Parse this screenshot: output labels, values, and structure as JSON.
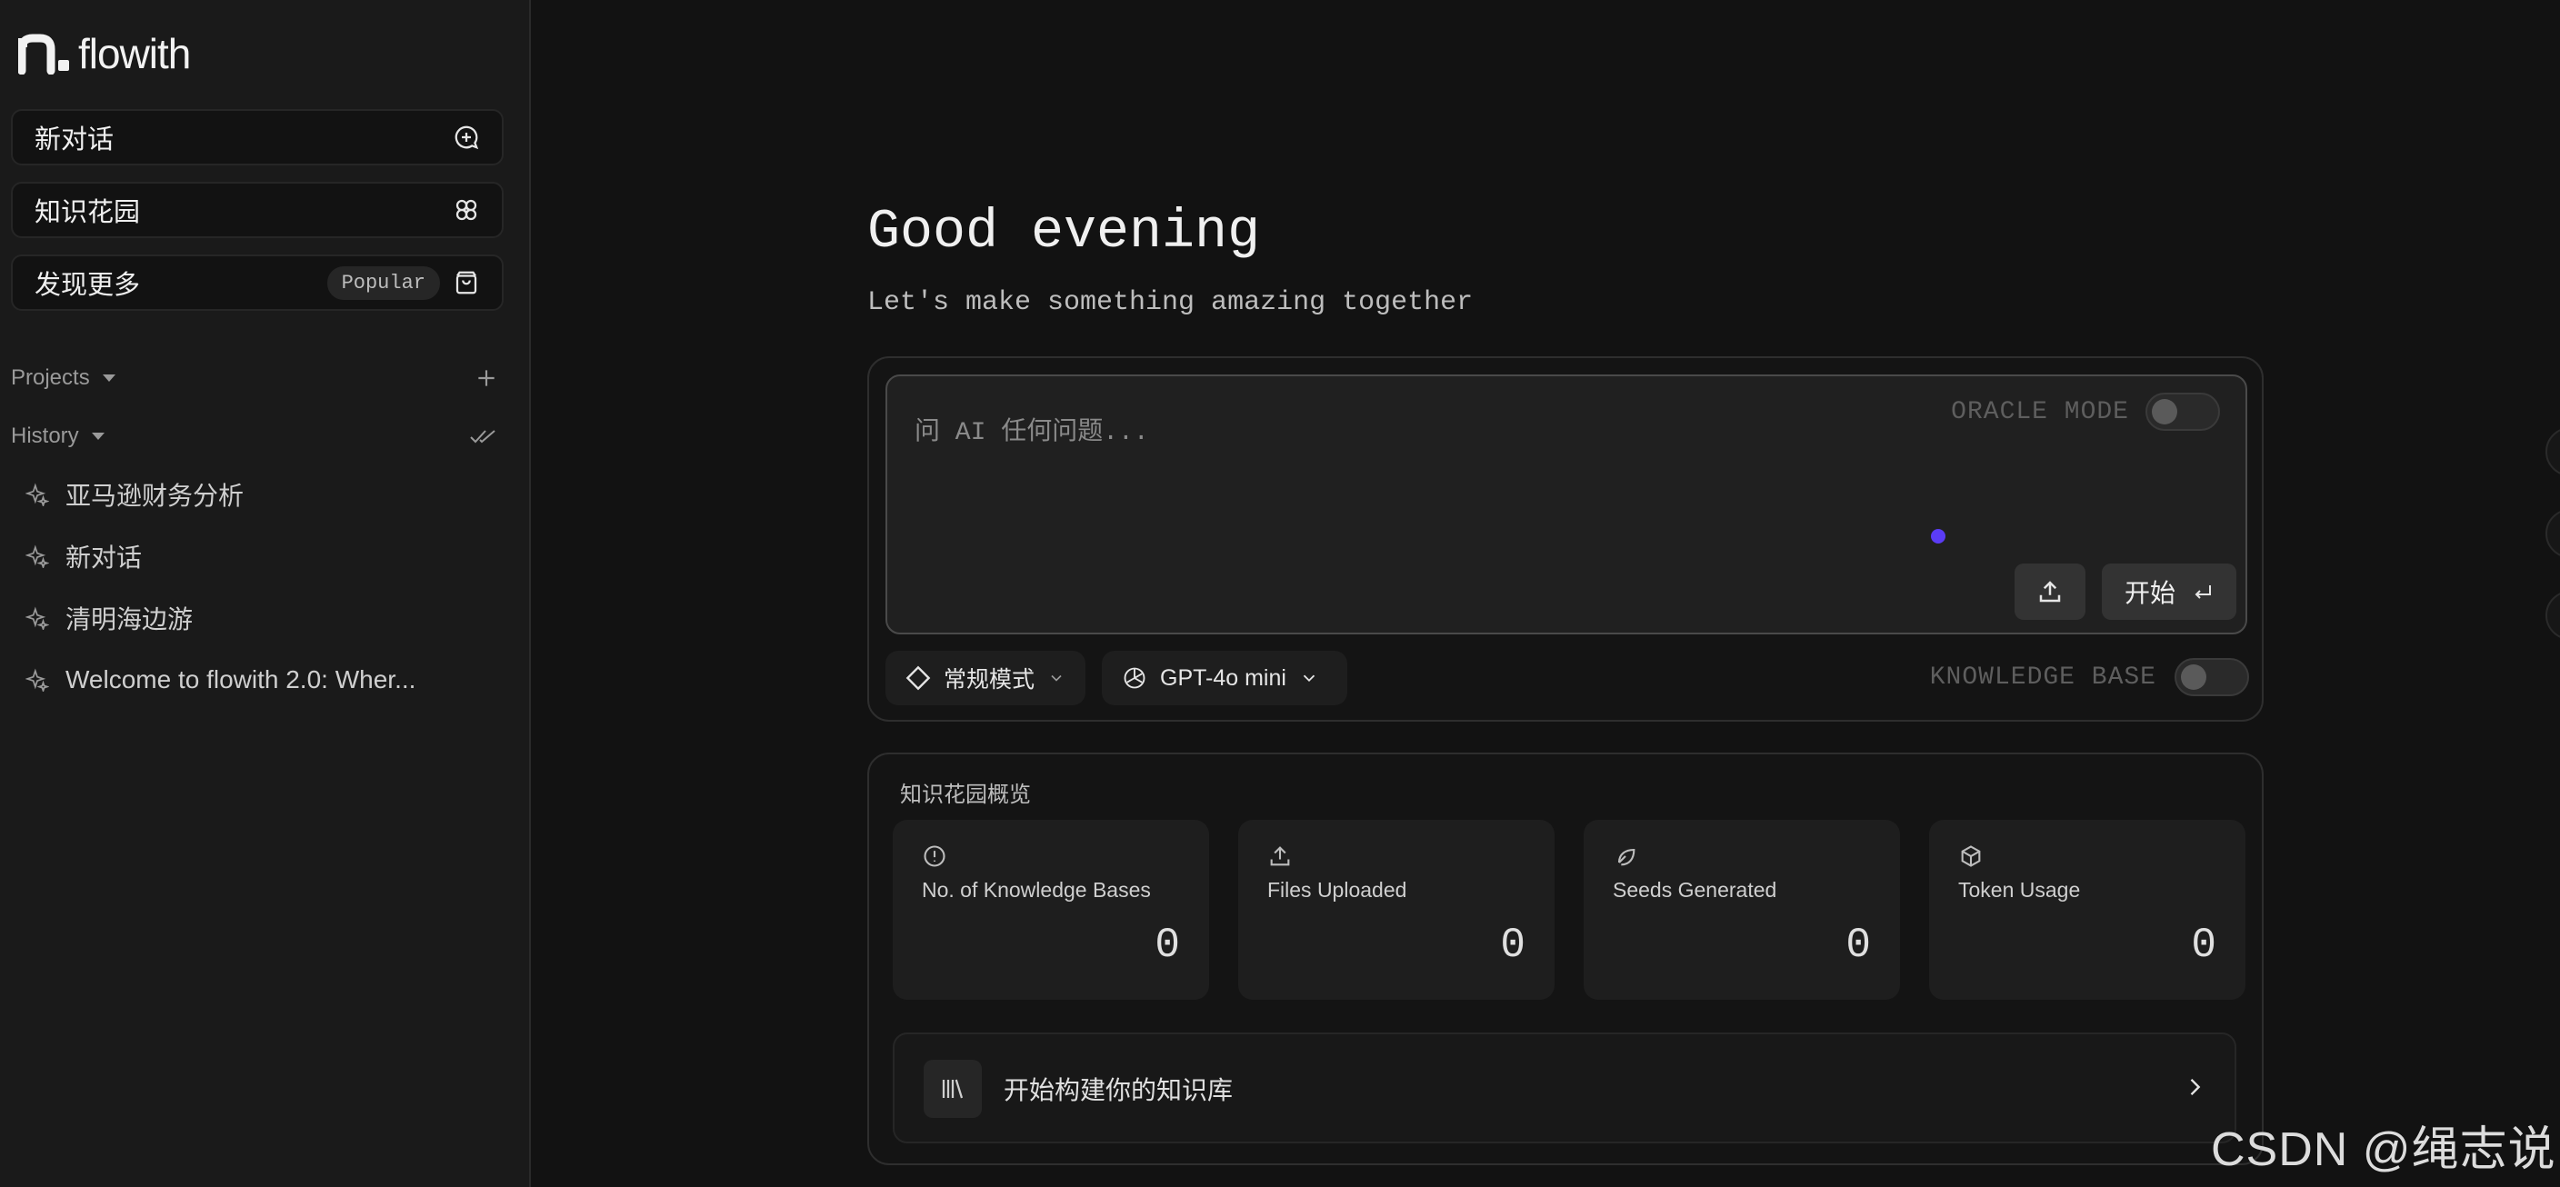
{
  "app": {
    "logo_text": "flowith"
  },
  "sidebar": {
    "new_chat": "新对话",
    "knowledge_garden": "知识花园",
    "discover": "发现更多",
    "discover_badge": "Popular",
    "projects_label": "Projects",
    "history_label": "History",
    "history_items": [
      "亚马逊财务分析",
      "新对话",
      "清明海边游",
      "Welcome to flowith 2.0: Wher..."
    ]
  },
  "main": {
    "greeting": "Good evening",
    "subtitle": "Let's make something amazing together",
    "input_placeholder": "问 AI 任何问题...",
    "oracle_mode": "ORACLE MODE",
    "start_label": "开始",
    "mode_label": "常规模式",
    "model_label": "GPT-4o mini",
    "knowledge_base": "KNOWLEDGE BASE"
  },
  "overview": {
    "title": "知识花园概览",
    "cards": [
      {
        "label": "No. of Knowledge Bases",
        "value": "0",
        "icon": "info-circle-icon"
      },
      {
        "label": "Files Uploaded",
        "value": "0",
        "icon": "upload-icon"
      },
      {
        "label": "Seeds Generated",
        "value": "0",
        "icon": "seed-icon"
      },
      {
        "label": "Token Usage",
        "value": "0",
        "icon": "cube-icon"
      }
    ],
    "cta_label": "开始构建你的知识库"
  },
  "watermark": "CSDN @绳志说"
}
